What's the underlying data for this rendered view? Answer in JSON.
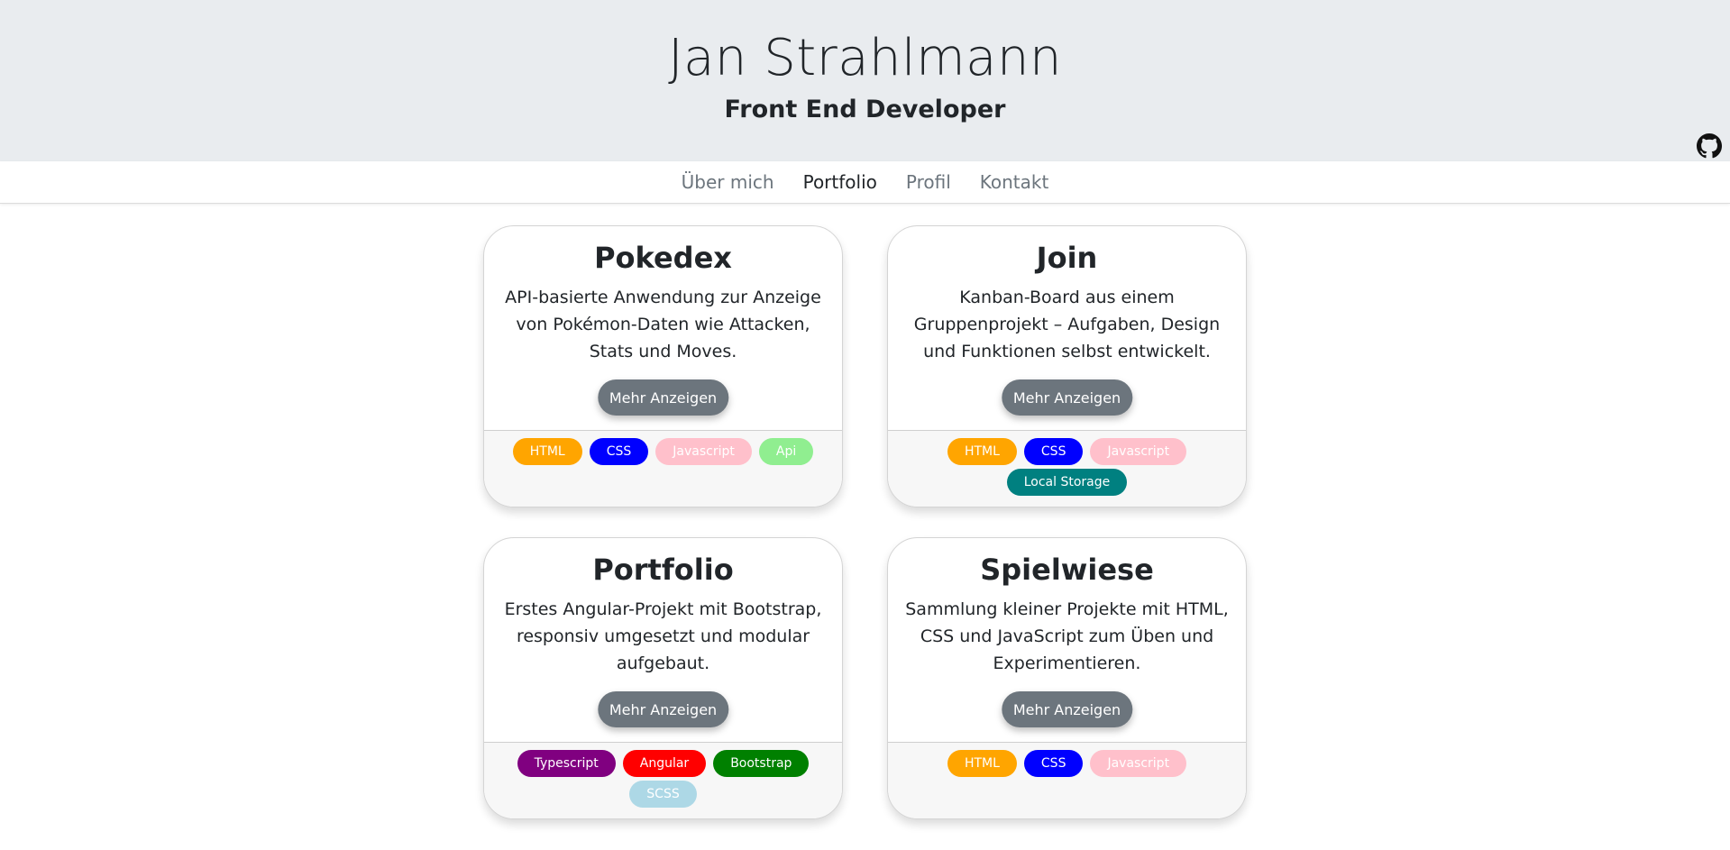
{
  "header": {
    "name": "Jan Strahlmann",
    "role": "Front End Developer",
    "github_icon": "github-icon"
  },
  "nav": {
    "items": [
      {
        "label": "Über mich",
        "active": false
      },
      {
        "label": "Portfolio",
        "active": true
      },
      {
        "label": "Profil",
        "active": false
      },
      {
        "label": "Kontakt",
        "active": false
      }
    ]
  },
  "colors": {
    "header_bg": "#e9ecef",
    "button_bg": "#6c757d",
    "html": "#ffa500",
    "css": "#0000ff",
    "javascript": "#ffc0cb",
    "api": "#90ee90",
    "local_storage": "#008080",
    "typescript": "#800080",
    "angular": "#ff0000",
    "bootstrap": "#008000",
    "scss": "#add8e6"
  },
  "projects": [
    {
      "title": "Pokedex",
      "description": "API-basierte Anwendung zur Anzeige von Pokémon-Daten wie Attacken, Stats und Moves.",
      "button": "Mehr Anzeigen",
      "tags": [
        {
          "label": "HTML",
          "color": "#ffa500"
        },
        {
          "label": "CSS",
          "color": "#0000ff"
        },
        {
          "label": "Javascript",
          "color": "#ffc0cb"
        },
        {
          "label": "Api",
          "color": "#90ee90"
        }
      ]
    },
    {
      "title": "Join",
      "description": "Kanban-Board aus einem Gruppenprojekt – Aufgaben, Design und Funktionen selbst entwickelt.",
      "button": "Mehr Anzeigen",
      "tags": [
        {
          "label": "HTML",
          "color": "#ffa500"
        },
        {
          "label": "CSS",
          "color": "#0000ff"
        },
        {
          "label": "Javascript",
          "color": "#ffc0cb"
        },
        {
          "label": "Local Storage",
          "color": "#008080"
        }
      ]
    },
    {
      "title": "Portfolio",
      "description": "Erstes Angular-Projekt mit Bootstrap, responsiv umgesetzt und modular aufgebaut.",
      "button": "Mehr Anzeigen",
      "tags": [
        {
          "label": "Typescript",
          "color": "#800080"
        },
        {
          "label": "Angular",
          "color": "#ff0000"
        },
        {
          "label": "Bootstrap",
          "color": "#008000"
        },
        {
          "label": "SCSS",
          "color": "#add8e6"
        }
      ]
    },
    {
      "title": "Spielwiese",
      "description": "Sammlung kleiner Projekte mit HTML, CSS und JavaScript zum Üben und Experimentieren.",
      "button": "Mehr Anzeigen",
      "tags": [
        {
          "label": "HTML",
          "color": "#ffa500"
        },
        {
          "label": "CSS",
          "color": "#0000ff"
        },
        {
          "label": "Javascript",
          "color": "#ffc0cb"
        }
      ]
    }
  ]
}
